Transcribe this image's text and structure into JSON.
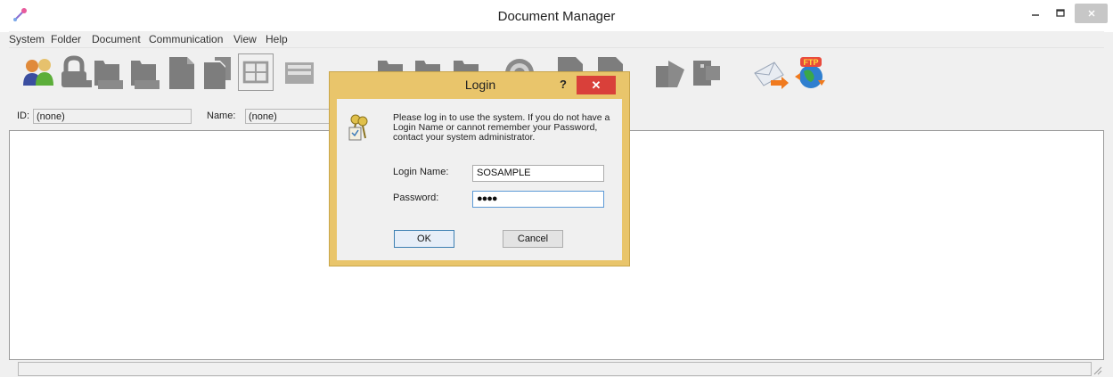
{
  "window": {
    "title": "Document Manager",
    "min_icon": "minimize-icon",
    "max_icon": "maximize-icon",
    "close_icon": "close-icon"
  },
  "menu": {
    "items": [
      "System",
      "Folder",
      "Document",
      "Communication",
      "View",
      "Help"
    ]
  },
  "toolbar": {
    "buttons": [
      "users-icon",
      "lock-icon",
      "folder-icon",
      "folder-icon",
      "document-icon",
      "document-icon",
      "grid-view-icon",
      "list-view-icon",
      "folder-icon",
      "folder-icon",
      "folder-icon",
      "help-icon",
      "document-icon",
      "document-icon",
      "document-icon",
      "document-icon",
      "send-mail-icon",
      "ftp-icon"
    ]
  },
  "idrow": {
    "id_label": "ID:",
    "id_value": "(none)",
    "name_label": "Name:",
    "name_value": "(none)"
  },
  "dialog": {
    "title": "Login",
    "help_label": "?",
    "close_label": "✕",
    "message": "Please log in to use the system.  If you do not have a Login Name or cannot remember your Password, contact your system administrator.",
    "login_label": "Login Name:",
    "login_value": "SOSAMPLE",
    "password_label": "Password:",
    "password_value": "●●●●",
    "ok_label": "OK",
    "cancel_label": "Cancel"
  },
  "colors": {
    "dialog_frame": "#e9c56b",
    "close_button": "#d9403a"
  }
}
